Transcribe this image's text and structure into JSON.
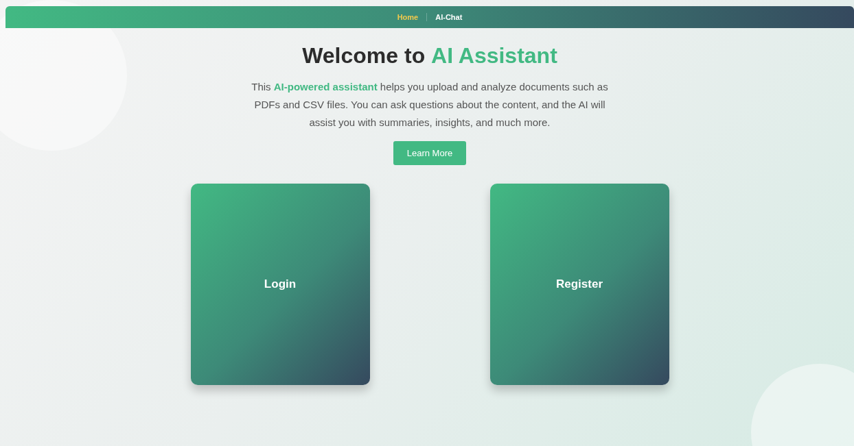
{
  "nav": [
    {
      "label": "Home",
      "selected": true
    },
    {
      "label": "AI-Chat",
      "selected": false
    }
  ],
  "hero": {
    "title": "Welcome to **AI Assistant**",
    "description": "This **AI-powered assistant** helps you upload and analyze documents such as PDFs and CSV files. You can ask questions about the content, and the AI will assist you with summaries, insights, and much more.",
    "button": "Learn More"
  },
  "cards": [
    {
      "label": "Login"
    },
    {
      "label": "Register"
    }
  ]
}
